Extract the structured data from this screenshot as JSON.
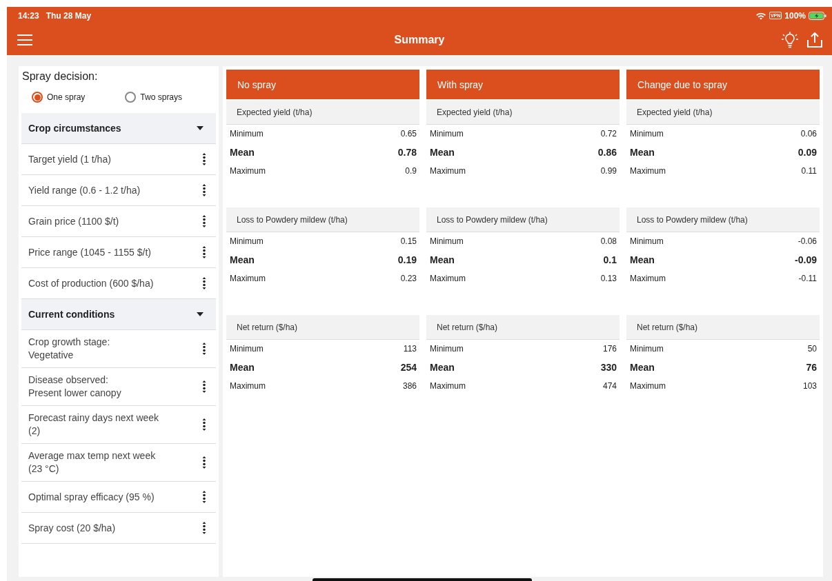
{
  "status_bar": {
    "time": "14:23",
    "date": "Thu 28 May",
    "vpn": "VPN",
    "battery": "100%"
  },
  "app_bar": {
    "title": "Summary"
  },
  "spray_decision": {
    "label": "Spray decision:",
    "options": [
      {
        "label": "One spray",
        "selected": true
      },
      {
        "label": "Two sprays",
        "selected": false
      }
    ]
  },
  "sections": [
    {
      "title": "Crop circumstances",
      "expanded": true,
      "items": [
        "Target yield (1 t/ha)",
        "Yield range (0.6 - 1.2 t/ha)",
        "Grain price (1100 $/t)",
        "Price range (1045 - 1155 $/t)",
        "Cost of production (600 $/ha)"
      ]
    },
    {
      "title": "Current conditions",
      "expanded": true,
      "items": [
        "Crop growth stage:\nVegetative",
        "Disease observed:\nPresent lower canopy",
        "Forecast rainy days next week\n(2)",
        "Average max temp next week\n(23 °C)",
        "Optimal spray efficacy (95 %)",
        "Spray cost (20 $/ha)"
      ]
    }
  ],
  "columns": [
    {
      "title": "No spray",
      "groups": [
        {
          "title": "Expected yield (t/ha)",
          "rows": [
            {
              "label": "Minimum",
              "value": "0.65",
              "kind": "plain"
            },
            {
              "label": "Mean",
              "value": "0.78",
              "kind": "mean"
            },
            {
              "label": "Maximum",
              "value": "0.9",
              "kind": "plain"
            }
          ]
        },
        {
          "title": "Loss to Powdery mildew (t/ha)",
          "rows": [
            {
              "label": "Minimum",
              "value": "0.15",
              "kind": "plain"
            },
            {
              "label": "Mean",
              "value": "0.19",
              "kind": "mean"
            },
            {
              "label": "Maximum",
              "value": "0.23",
              "kind": "plain"
            }
          ]
        },
        {
          "title": "Net return ($/ha)",
          "rows": [
            {
              "label": "Minimum",
              "value": "113",
              "kind": "plain"
            },
            {
              "label": "Mean",
              "value": "254",
              "kind": "mean"
            },
            {
              "label": "Maximum",
              "value": "386",
              "kind": "plain"
            }
          ]
        }
      ]
    },
    {
      "title": "With spray",
      "groups": [
        {
          "title": "Expected yield (t/ha)",
          "rows": [
            {
              "label": "Minimum",
              "value": "0.72",
              "kind": "plain"
            },
            {
              "label": "Mean",
              "value": "0.86",
              "kind": "mean"
            },
            {
              "label": "Maximum",
              "value": "0.99",
              "kind": "plain"
            }
          ]
        },
        {
          "title": "Loss to Powdery mildew (t/ha)",
          "rows": [
            {
              "label": "Minimum",
              "value": "0.08",
              "kind": "plain"
            },
            {
              "label": "Mean",
              "value": "0.1",
              "kind": "mean"
            },
            {
              "label": "Maximum",
              "value": "0.13",
              "kind": "plain"
            }
          ]
        },
        {
          "title": "Net return ($/ha)",
          "rows": [
            {
              "label": "Minimum",
              "value": "176",
              "kind": "plain"
            },
            {
              "label": "Mean",
              "value": "330",
              "kind": "mean"
            },
            {
              "label": "Maximum",
              "value": "474",
              "kind": "plain"
            }
          ]
        }
      ]
    },
    {
      "title": "Change due to spray",
      "groups": [
        {
          "title": "Expected yield (t/ha)",
          "rows": [
            {
              "label": "Minimum",
              "value": "0.06",
              "kind": "plain"
            },
            {
              "label": "Mean",
              "value": "0.09",
              "kind": "mean"
            },
            {
              "label": "Maximum",
              "value": "0.11",
              "kind": "plain"
            }
          ]
        },
        {
          "title": "Loss to Powdery mildew (t/ha)",
          "rows": [
            {
              "label": "Minimum",
              "value": "-0.06",
              "kind": "plain"
            },
            {
              "label": "Mean",
              "value": "-0.09",
              "kind": "mean"
            },
            {
              "label": "Maximum",
              "value": "-0.11",
              "kind": "plain"
            }
          ]
        },
        {
          "title": "Net return ($/ha)",
          "rows": [
            {
              "label": "Minimum",
              "value": "50",
              "kind": "plain"
            },
            {
              "label": "Mean",
              "value": "76",
              "kind": "mean"
            },
            {
              "label": "Maximum",
              "value": "103",
              "kind": "plain"
            }
          ]
        }
      ]
    }
  ]
}
